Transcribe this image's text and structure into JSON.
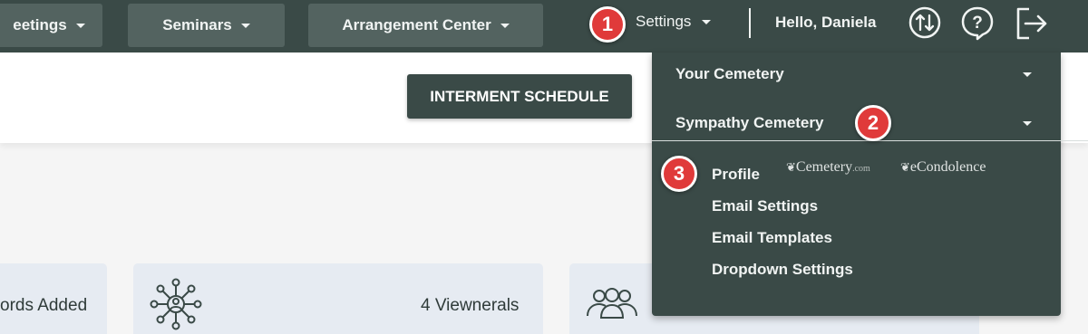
{
  "topnav": {
    "items": [
      {
        "label": "eetings"
      },
      {
        "label": "Seminars"
      },
      {
        "label": "Arrangement Center"
      }
    ],
    "settings_label": "Settings",
    "greeting": "Hello, Daniela",
    "icons": [
      "sort-arrows-icon",
      "help-icon",
      "logout-icon"
    ]
  },
  "toolbar": {
    "interment_label": "INTERMENT SCHEDULE"
  },
  "stats": {
    "records_label": "ords Added",
    "viewnerals_label": "4 Viewnerals"
  },
  "dropdown": {
    "sections": [
      {
        "label": "Your Cemetery"
      },
      {
        "label": "Sympathy Cemetery"
      }
    ],
    "subitems": [
      {
        "label": "Profile"
      },
      {
        "label": "Email Settings"
      },
      {
        "label": "Email Templates"
      },
      {
        "label": "Dropdown Settings"
      }
    ],
    "brands": {
      "cemetery_main": "Cemetery",
      "cemetery_suffix": ".com",
      "econdolence": "eCondolence"
    }
  },
  "badges": [
    "1",
    "2",
    "3"
  ],
  "colors": {
    "nav_bg": "#3a4a47",
    "nav_button": "#536360",
    "badge_red": "#e03a3a",
    "card_bg": "#e6ebf2"
  }
}
